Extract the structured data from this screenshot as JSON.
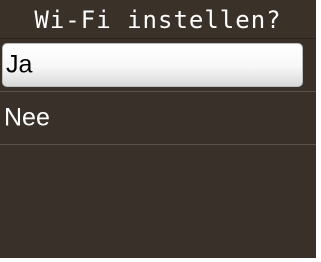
{
  "dialog": {
    "title": "Wi-Fi instellen?"
  },
  "options": [
    {
      "label": "Ja",
      "selected": true
    },
    {
      "label": "Nee",
      "selected": false
    }
  ],
  "colors": {
    "background": "#393129",
    "selected_bg": "#ffffff",
    "text": "#ffffff",
    "selected_text": "#000000"
  }
}
